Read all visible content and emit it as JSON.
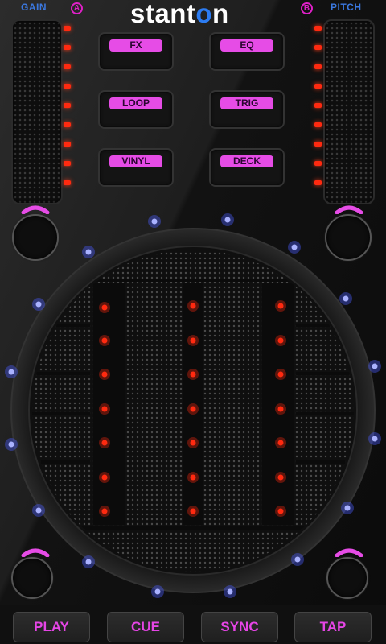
{
  "header": {
    "gain_label": "GAIN",
    "pitch_label": "PITCH",
    "deck_a": "A",
    "deck_b": "B",
    "brand_pre": "stant",
    "brand_accent": "o",
    "brand_post": "n"
  },
  "pads": {
    "fx": "FX",
    "eq": "EQ",
    "loop": "LOOP",
    "trig": "TRIG",
    "vinyl": "VINYL",
    "deck": "DECK"
  },
  "transport": {
    "play": "PLAY",
    "cue": "CUE",
    "sync": "SYNC",
    "tap": "TAP"
  },
  "colors": {
    "accent_magenta": "#e64ce6",
    "accent_blue": "#2c7cf2",
    "led_red": "#ff2a10",
    "ring_blue": "#4a5cff"
  },
  "icons": {
    "gain_knob": "knob-icon",
    "pitch_knob": "knob-icon",
    "jog_wheel": "jog-wheel-icon"
  }
}
